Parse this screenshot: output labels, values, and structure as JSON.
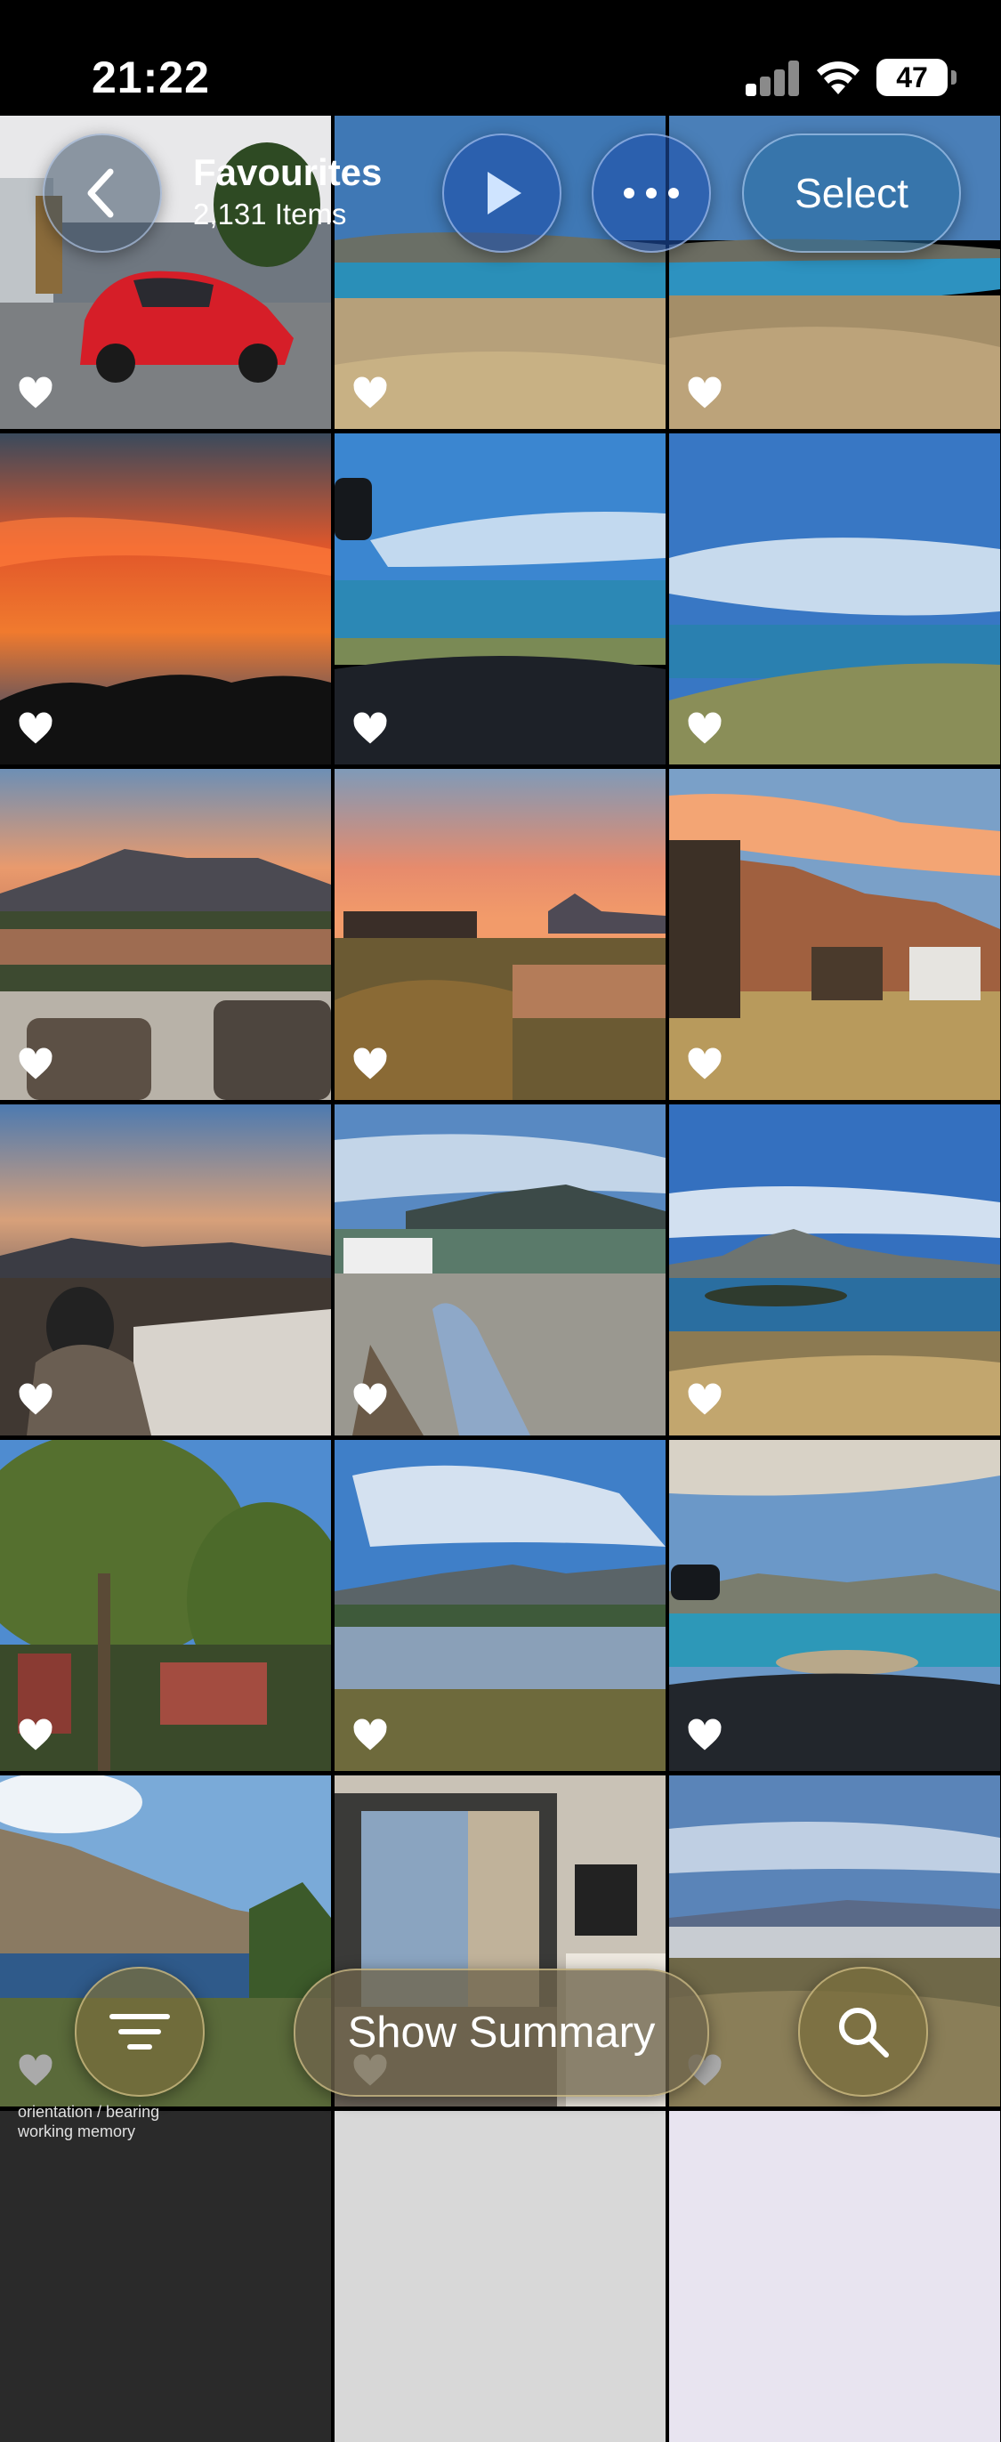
{
  "status_bar": {
    "time": "21:22",
    "battery": "47"
  },
  "header": {
    "title": "Favourites",
    "subtitle": "2,131 Items",
    "select_label": "Select",
    "icons": {
      "back": "chevron-left-icon",
      "play": "play-icon",
      "more": "ellipsis-icon"
    }
  },
  "grid": {
    "columns": 3,
    "photos": [
      {
        "desc": "red car in driveway",
        "favourite": true
      },
      {
        "desc": "lake and dry hills",
        "favourite": true
      },
      {
        "desc": "lake and dry hills",
        "favourite": true
      },
      {
        "desc": "orange sunset sky",
        "favourite": true
      },
      {
        "desc": "lake view through windscreen",
        "favourite": true
      },
      {
        "desc": "lake and green hill",
        "favourite": true
      },
      {
        "desc": "sunset over pond with chairs",
        "favourite": true
      },
      {
        "desc": "sunset over pond and reeds",
        "favourite": true
      },
      {
        "desc": "mountains and houses",
        "favourite": true
      },
      {
        "desc": "person at table on deck",
        "favourite": true
      },
      {
        "desc": "legs on lounger by pond",
        "favourite": true
      },
      {
        "desc": "lake with island",
        "favourite": true
      },
      {
        "desc": "trees and buildings",
        "favourite": true
      },
      {
        "desc": "pond with mountains",
        "favourite": true
      },
      {
        "desc": "lake through car window",
        "favourite": true
      },
      {
        "desc": "mountain and lake",
        "favourite": true
      },
      {
        "desc": "room with balcony door",
        "favourite": true
      },
      {
        "desc": "valley and distant mountains",
        "favourite": true
      }
    ]
  },
  "bottom_bar": {
    "summary_label": "Show Summary",
    "icons": {
      "filter": "filter-lines-icon",
      "search": "search-icon"
    }
  },
  "underlying_text": [
    "orientation / bearing",
    "working memory"
  ]
}
